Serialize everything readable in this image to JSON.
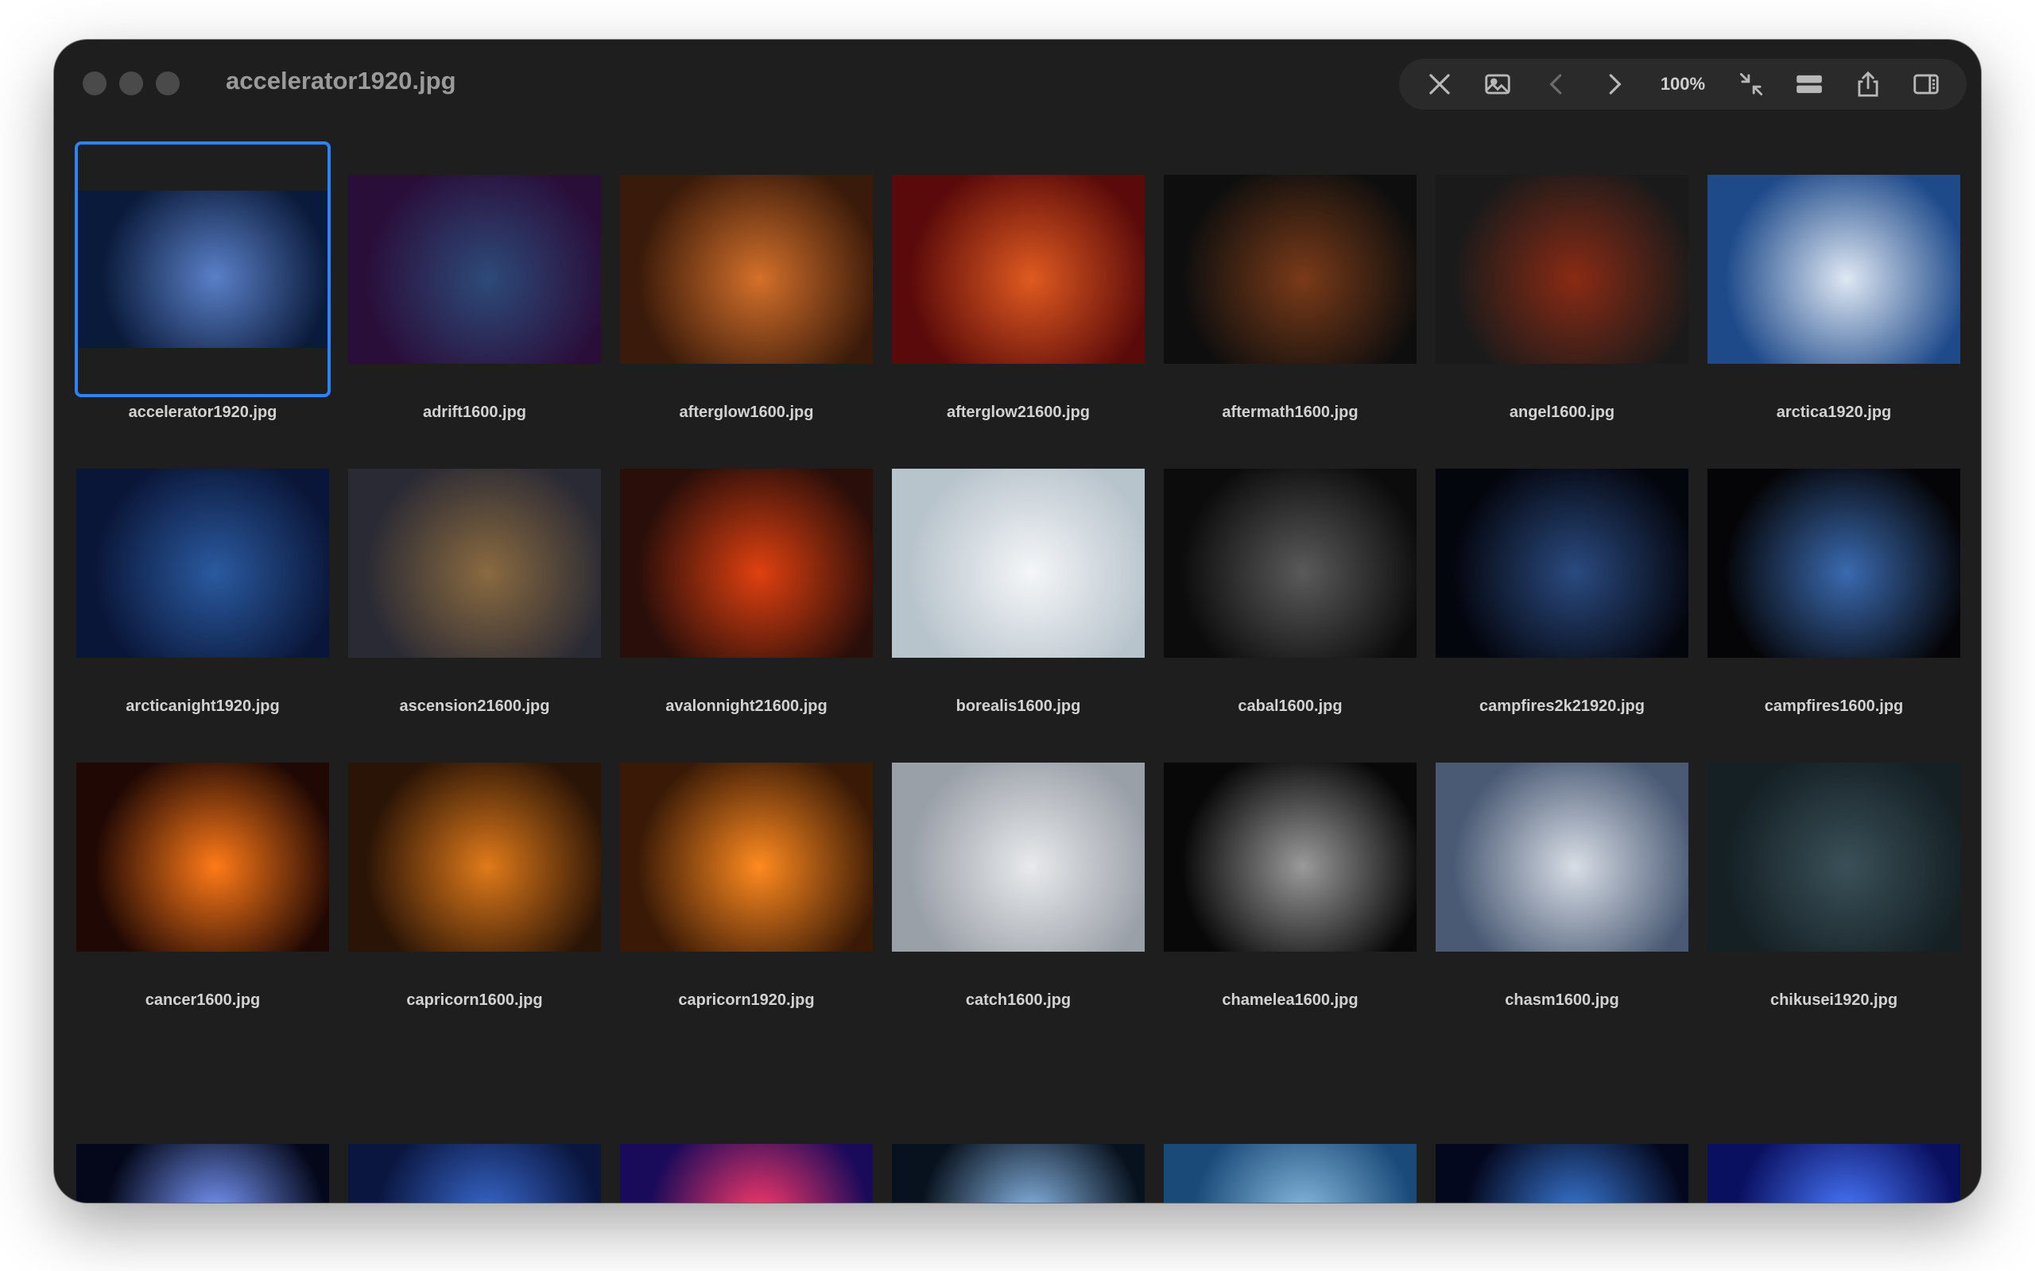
{
  "window": {
    "title": "accelerator1920.jpg"
  },
  "toolbar": {
    "zoom": "100%",
    "icons": [
      "close-icon",
      "image-icon",
      "chevron-left-icon",
      "chevron-right-icon",
      "collapse-icon",
      "strip-icon",
      "share-icon",
      "sidebar-icon"
    ]
  },
  "files": [
    {
      "name": "accelerator1920.jpg",
      "c1": "#0a1a3a",
      "c2": "#5a80c8"
    },
    {
      "name": "adrift1600.jpg",
      "c1": "#2a0e3a",
      "c2": "#2d4a78"
    },
    {
      "name": "afterglow1600.jpg",
      "c1": "#3a1a0a",
      "c2": "#d4702a"
    },
    {
      "name": "afterglow21600.jpg",
      "c1": "#5a0a0a",
      "c2": "#e05a20"
    },
    {
      "name": "aftermath1600.jpg",
      "c1": "#0e0e0e",
      "c2": "#7a3a18"
    },
    {
      "name": "angel1600.jpg",
      "c1": "#1a1a1a",
      "c2": "#8a2a14"
    },
    {
      "name": "arctica1920.jpg",
      "c1": "#1e4a8a",
      "c2": "#dfe8f4"
    },
    {
      "name": "arcticanight1920.jpg",
      "c1": "#0a1638",
      "c2": "#2a5aa0"
    },
    {
      "name": "ascension21600.jpg",
      "c1": "#2a2a34",
      "c2": "#8a6a40"
    },
    {
      "name": "avalonnight21600.jpg",
      "c1": "#2a0e0a",
      "c2": "#e04010"
    },
    {
      "name": "borealis1600.jpg",
      "c1": "#b8c4cc",
      "c2": "#f4f6f8"
    },
    {
      "name": "cabal1600.jpg",
      "c1": "#0c0c0c",
      "c2": "#5a5a5a"
    },
    {
      "name": "campfires2k21920.jpg",
      "c1": "#04060e",
      "c2": "#2a4a80"
    },
    {
      "name": "campfires1600.jpg",
      "c1": "#050508",
      "c2": "#3a6ab0"
    },
    {
      "name": "cancer1600.jpg",
      "c1": "#200804",
      "c2": "#ff7a18"
    },
    {
      "name": "capricorn1600.jpg",
      "c1": "#2a1406",
      "c2": "#e07a1a"
    },
    {
      "name": "capricorn1920.jpg",
      "c1": "#3a1a06",
      "c2": "#ff8a20"
    },
    {
      "name": "catch1600.jpg",
      "c1": "#9aa0a8",
      "c2": "#e8eaec"
    },
    {
      "name": "chamelea1600.jpg",
      "c1": "#080808",
      "c2": "#9a9a9a"
    },
    {
      "name": "chasm1600.jpg",
      "c1": "#4a5a74",
      "c2": "#d8dee6"
    },
    {
      "name": "chikusei1920.jpg",
      "c1": "#142024",
      "c2": "#3a5058"
    },
    {
      "name": "",
      "c1": "#04081a",
      "c2": "#7a9aff"
    },
    {
      "name": "",
      "c1": "#0a1640",
      "c2": "#3a6ad0"
    },
    {
      "name": "",
      "c1": "#1a0a5a",
      "c2": "#ff3a6a"
    },
    {
      "name": "",
      "c1": "#08121e",
      "c2": "#8ab8e8"
    },
    {
      "name": "",
      "c1": "#1a4a78",
      "c2": "#8abce0"
    },
    {
      "name": "",
      "c1": "#04081e",
      "c2": "#3a7ad8"
    },
    {
      "name": "",
      "c1": "#0a1060",
      "c2": "#4a7aff"
    }
  ]
}
